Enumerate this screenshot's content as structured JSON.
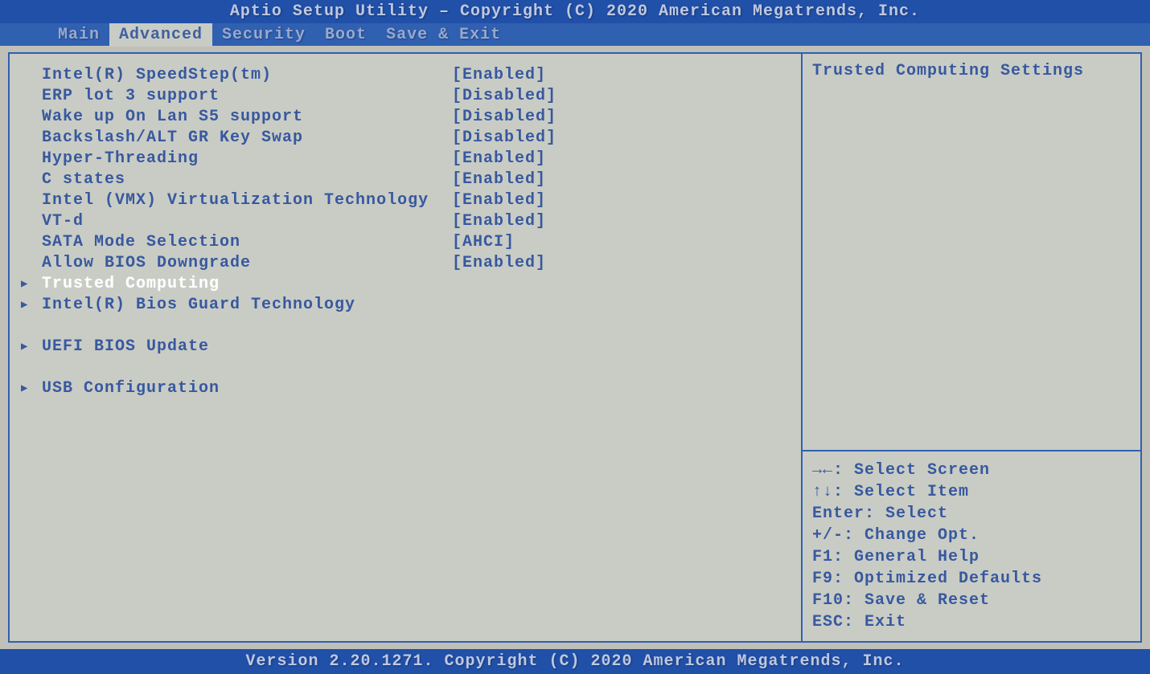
{
  "header": {
    "title": "Aptio Setup Utility – Copyright (C) 2020 American Megatrends, Inc."
  },
  "tabs": [
    {
      "label": "Main",
      "active": false
    },
    {
      "label": "Advanced",
      "active": true
    },
    {
      "label": "Security",
      "active": false
    },
    {
      "label": "Boot",
      "active": false
    },
    {
      "label": "Save & Exit",
      "active": false
    }
  ],
  "settings": [
    {
      "label": "Intel(R) SpeedStep(tm)",
      "value": "[Enabled]"
    },
    {
      "label": "ERP lot 3 support",
      "value": "[Disabled]"
    },
    {
      "label": "Wake up On Lan S5 support",
      "value": "[Disabled]"
    },
    {
      "label": "Backslash/ALT GR Key Swap",
      "value": "[Disabled]"
    },
    {
      "label": "Hyper-Threading",
      "value": "[Enabled]"
    },
    {
      "label": "C states",
      "value": "[Enabled]"
    },
    {
      "label": "Intel (VMX) Virtualization Technology",
      "value": "[Enabled]",
      "multiline": true
    },
    {
      "label": "VT-d",
      "value": "[Enabled]"
    },
    {
      "label": "SATA Mode Selection",
      "value": "[AHCI]"
    },
    {
      "label": "Allow BIOS Downgrade",
      "value": "[Enabled]"
    }
  ],
  "submenus": [
    {
      "label": "Trusted Computing",
      "selected": true
    },
    {
      "label": "Intel(R) Bios Guard Technology",
      "selected": false
    },
    {
      "label": "",
      "blank": true
    },
    {
      "label": "UEFI BIOS Update",
      "selected": false
    },
    {
      "label": "",
      "blank": true
    },
    {
      "label": "USB Configuration",
      "selected": false
    }
  ],
  "help_text": "Trusted Computing Settings",
  "legend": [
    "→←: Select Screen",
    "↑↓: Select Item",
    "Enter: Select",
    "+/-: Change Opt.",
    "F1: General Help",
    "F9: Optimized Defaults",
    "F10: Save & Reset",
    "ESC: Exit"
  ],
  "footer": {
    "text": "Version 2.20.1271. Copyright (C) 2020 American Megatrends, Inc."
  }
}
